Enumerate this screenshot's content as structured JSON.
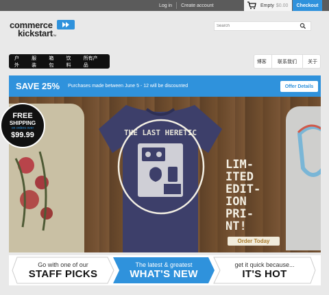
{
  "topbar": {
    "login": "Log in",
    "create_account": "Create account",
    "cart_label": "Empty",
    "cart_amount": "$0.00",
    "checkout": "Checkout"
  },
  "logo": {
    "line1": "commerce",
    "line2": "kickstart",
    "tm": "TM"
  },
  "search": {
    "placeholder": "Search"
  },
  "nav_left": [
    "户外",
    "服装",
    "箱包",
    "饮料",
    "所有产品"
  ],
  "nav_right": [
    "博客",
    "联系我们",
    "关于"
  ],
  "promo": {
    "title": "SAVE 25%",
    "description": "Purchases made between June 5 - 12 will be discounted",
    "button": "Offer Details"
  },
  "hero": {
    "shirt_text": "THE LAST HERETIC",
    "limited_lines": [
      "LIM-",
      "ITED",
      "EDIT-",
      "ION",
      "PRI-",
      "NT!"
    ],
    "order_button": "Order Today",
    "free_shipping": {
      "line1": "FREE",
      "line2": "SHIPPING",
      "line3": "on orders over",
      "line4": "$99.99"
    }
  },
  "tabs": [
    {
      "sub": "Go with one of our",
      "main": "STAFF PICKS"
    },
    {
      "sub": "The latest & greatest",
      "main": "WHAT'S NEW"
    },
    {
      "sub": "get it quick because...",
      "main": "IT'S HOT"
    }
  ],
  "colors": {
    "accent": "#2f92dc",
    "topbar": "#5b5b5b",
    "nav_dark": "#111111"
  }
}
